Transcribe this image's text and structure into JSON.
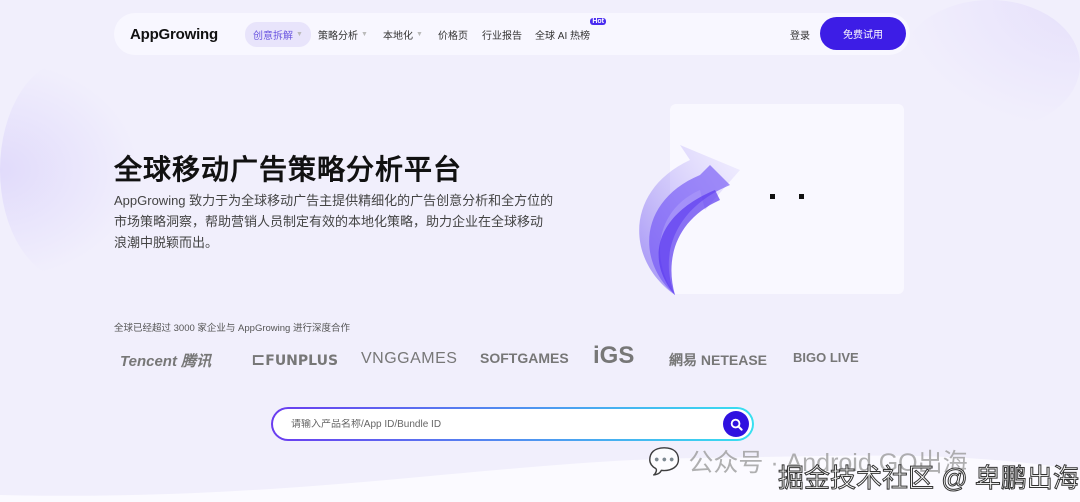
{
  "nav": {
    "logo": "AppGrowing",
    "items": [
      {
        "label": "创意拆解",
        "dropdown": true,
        "active": true
      },
      {
        "label": "策略分析",
        "dropdown": true
      },
      {
        "label": "本地化",
        "dropdown": true
      },
      {
        "label": "价格页"
      },
      {
        "label": "行业报告"
      },
      {
        "label": "全球 AI 热榜",
        "badge": "Hot"
      }
    ],
    "login": "登录",
    "trial": "免费试用"
  },
  "hero": {
    "title": "全球移动广告策略分析平台",
    "description": "AppGrowing 致力于为全球移动广告主提供精细化的广告创意分析和全方位的市场策略洞察，帮助营销人员制定有效的本地化策略，助力企业在全球移动浪潮中脱颖而出。"
  },
  "partners": {
    "caption": "全球已经超过 3000 家企业与 AppGrowing 进行深度合作",
    "logos": [
      "Tencent 腾讯",
      "FUNPLUS",
      "VNGGAMES",
      "SOFTGAMES",
      "iGS",
      "網易 NETEASE",
      "BIGO LIVE"
    ]
  },
  "search": {
    "placeholder": "请输入产品名称/App ID/Bundle ID"
  },
  "watermark": {
    "line1": "公众号 · Android GO出海",
    "line2": "掘金技术社区 @ 卑鹏出海"
  },
  "colors": {
    "accent": "#3d1de6",
    "background": "#f1effc"
  }
}
